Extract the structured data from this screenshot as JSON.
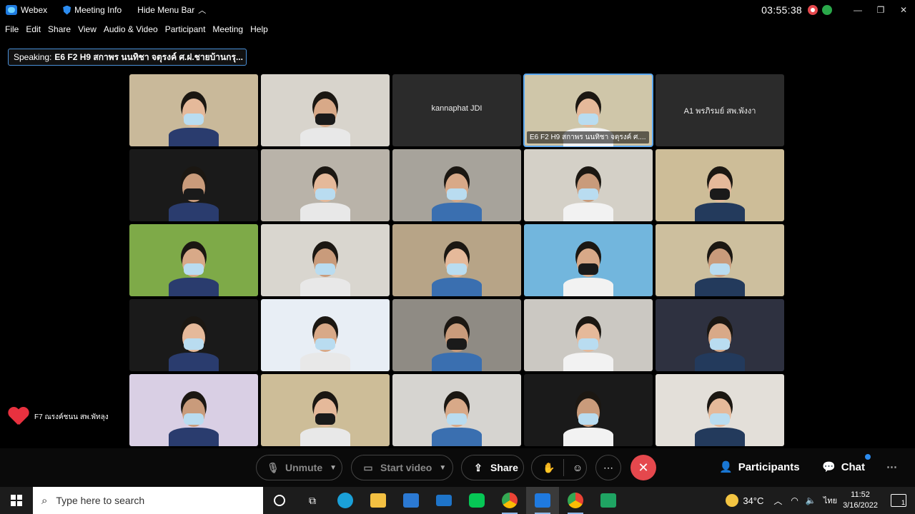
{
  "titlebar": {
    "app": "Webex",
    "meeting_info": "Meeting Info",
    "hide_menu": "Hide Menu Bar",
    "clock": "03:55:38"
  },
  "menu": [
    "File",
    "Edit",
    "Share",
    "View",
    "Audio & Video",
    "Participant",
    "Meeting",
    "Help"
  ],
  "speaking": {
    "label": "Speaking:",
    "name": "E6 F2 H9 สกาพร นนทิชา จตุรงค์ ศ.ฝ.ชายบ้านกรุ..."
  },
  "tiles": [
    {
      "kind": "video",
      "bg": "#c9b99a"
    },
    {
      "kind": "video",
      "bg": "#d8d4cc"
    },
    {
      "kind": "name",
      "name": "kannaphat JDI"
    },
    {
      "kind": "video",
      "bg": "#cfc6a9",
      "active": true,
      "label": "E6 F2 H9 สกาพร นนทิชา จตุรงค์ ศ...."
    },
    {
      "kind": "name",
      "name": "A1 พรภิรมย์ สพ.พังงา"
    },
    {
      "kind": "video",
      "bg": "#1a1a1a"
    },
    {
      "kind": "video",
      "bg": "#b9b3a9"
    },
    {
      "kind": "video",
      "bg": "#a7a39b"
    },
    {
      "kind": "video",
      "bg": "#d4d0c7"
    },
    {
      "kind": "video",
      "bg": "#cdbd98"
    },
    {
      "kind": "video",
      "bg": "#7eaa48"
    },
    {
      "kind": "video",
      "bg": "#d9d6cf"
    },
    {
      "kind": "video",
      "bg": "#b7a487"
    },
    {
      "kind": "video",
      "bg": "#72b6dd"
    },
    {
      "kind": "video",
      "bg": "#cdbf9e"
    },
    {
      "kind": "video",
      "bg": "#1a1a1a"
    },
    {
      "kind": "video",
      "bg": "#e8eef5"
    },
    {
      "kind": "video",
      "bg": "#8f8b84"
    },
    {
      "kind": "video",
      "bg": "#cbc8c2"
    },
    {
      "kind": "video",
      "bg": "#2e3140"
    },
    {
      "kind": "video",
      "bg": "#d9cfe4"
    },
    {
      "kind": "video",
      "bg": "#cdbd98"
    },
    {
      "kind": "video",
      "bg": "#d6d4d0"
    },
    {
      "kind": "video",
      "bg": "#1a1a1a"
    },
    {
      "kind": "video",
      "bg": "#e3dfd9"
    }
  ],
  "reaction": {
    "name": "F7 ณรงค์ชนน สพ.พัทลุง",
    "color": "#e8313f"
  },
  "controls": {
    "unmute": "Unmute",
    "start_video": "Start video",
    "share": "Share",
    "participants": "Participants",
    "chat": "Chat",
    "end_color": "#e5484d"
  },
  "taskbar": {
    "search_placeholder": "Type here to search",
    "temperature": "34°C",
    "language": "ไทย",
    "time": "11:52",
    "date": "3/16/2022",
    "notification_count": "1"
  }
}
